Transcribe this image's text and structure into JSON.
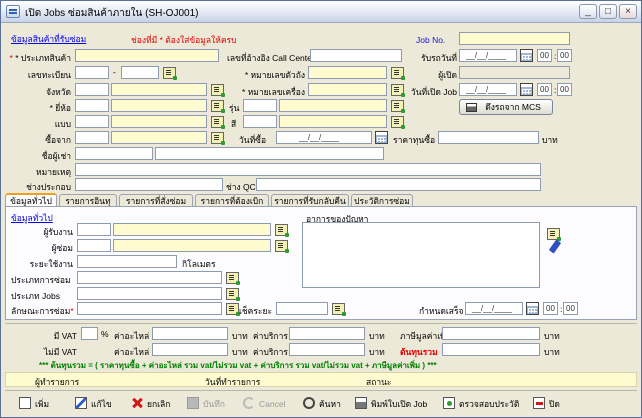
{
  "window": {
    "title": "เปิด Jobs ซ่อมสินค้าภายใน (SH-OJ001)",
    "controls": {
      "minimize": "_",
      "maximize": "□",
      "close": "×"
    }
  },
  "header": {
    "section_link": "ข้อมูลสินค้าที่รับซ่อม",
    "required_note": "ช่องที่มี * ต้องใส่ข้อมูลให้ครบ",
    "job_no_label": "Job No.",
    "receive_date_label": "รับรถวันที่",
    "opener_label": "ผู้เปิด",
    "open_job_date_label": "วันที่เปิด Job",
    "pull_mcs_button": "ดึงรถจาก MCS",
    "date_placeholder": "__/__/____",
    "time_hour": "00",
    "time_min": "00",
    "time_sep": ":"
  },
  "form": {
    "product_type": "* ประเภทสินค้า",
    "callcenter_ref": "เลขที่อ้างอิง Call Center",
    "plate_no": "เลขทะเบียน",
    "plate_sep": "-",
    "chassis_no": "* หมายเลขตัวถัง",
    "province": "จังหวัด",
    "engine_no": "* หมายเลขเครื่อง",
    "brand": "* ยี่ห้อ",
    "model": "รุ่น",
    "style": "แบบ",
    "color": "สี",
    "buy_from": "ซื้อจาก",
    "buy_date": "วันที่ซื้อ",
    "buy_price": "ราคาทุนซื้อ",
    "baht": "บาท",
    "renter": "ชื่อผู้เช่า",
    "note": "หมายเหตุ",
    "insurer": "ช่างประกอบ",
    "qc_tech": "ช่าง QC"
  },
  "tabs": [
    {
      "label": "ข้อมูลทั่วไป"
    },
    {
      "label": "รายการอินทุ"
    },
    {
      "label": "รายการที่สั่งซ่อม"
    },
    {
      "label": "รายการที่ต้องเบิก"
    },
    {
      "label": "รายการที่รับกลับคืน"
    },
    {
      "label": "ประวัติการซ่อม"
    }
  ],
  "general": {
    "section_link": "ข้อมูลทั่วไป",
    "receiver": "ผู้รับงาน",
    "repairer": "ผู้ซ่อม",
    "distance": "ระยะใช้งาน",
    "km": "กิโลเมตร",
    "repair_type": "ประเภทการซ่อม",
    "job_type": "ประเภท Jobs",
    "repair_nature": "ลักษณะการซ่อม",
    "warranty": "เช็คระยะ",
    "problem": "อาการของปัญหา",
    "finish_date": "กำหนดเสร็จ"
  },
  "summary": {
    "vat": "มี VAT",
    "percent": "%",
    "no_vat": "ไม่มี VAT",
    "parts_cost": "ค่าอะไหล่",
    "service_cost": "ค่าบริการ",
    "vat_amount": "ภาษีมูลค่าเพิ่ม",
    "total_cost": "ต้นทุนรวม",
    "baht": "บาท",
    "formula": "*** ต้นทุนรวม = ( ราคาทุนซื้อ + ค่าอะไหล่ รวม vat/ไม่รวม vat + ค่าบริการ รวม vat/ไม่รวม vat + ภาษีมูลค่าเพิ่ม ) ***"
  },
  "status_bar": {
    "recorder": "ผู้ทำรายการ",
    "record_date": "วันที่ทำรายการ",
    "status": "สถานะ"
  },
  "toolbar": {
    "new": "เพิ่ม",
    "edit": "แก้ไข",
    "cancel": "ยกเลิก",
    "save": "บันทึก",
    "undo": "Cancel",
    "find": "ค้นหา",
    "print_job": "พิมพ์ใบเปิด Job",
    "check_history": "ตรวจสอบประวัติ",
    "close": "ปิด"
  }
}
